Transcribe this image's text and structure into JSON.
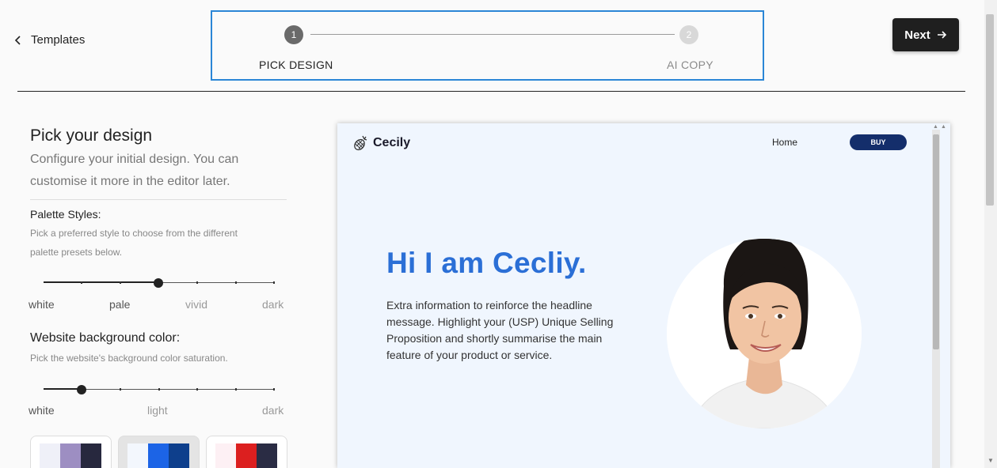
{
  "header": {
    "back_label": "Templates",
    "steps": [
      {
        "number": "1",
        "label": "PICK DESIGN"
      },
      {
        "number": "2",
        "label": "AI COPY"
      }
    ],
    "next_label": "Next"
  },
  "panel": {
    "title": "Pick your design",
    "description": "Configure your initial design. You can customise it more in the editor later.",
    "palette": {
      "label": "Palette Styles:",
      "help": "Pick a preferred style to choose from the different palette presets below.",
      "stops": [
        "white",
        "pale",
        "vivid",
        "dark"
      ],
      "selected": "pale"
    },
    "background": {
      "label": "Website background color:",
      "help": "Pick the website's background color saturation.",
      "stops": [
        "white",
        "light",
        "dark"
      ],
      "selected_fraction": 0.166
    },
    "swatches": [
      {
        "colors": [
          "#eff0f8",
          "#9d8ec2",
          "#27283e"
        ],
        "selected": false
      },
      {
        "colors": [
          "#f3f7fd",
          "#1c64e6",
          "#0e3f8c"
        ],
        "selected": true
      },
      {
        "colors": [
          "#fdf0f4",
          "#dc1f1f",
          "#2a2c44"
        ],
        "selected": false
      }
    ]
  },
  "preview": {
    "brand": "Cecily",
    "nav_home": "Home",
    "buy_label": "BUY",
    "hero_title": "Hi I am Cecliy.",
    "hero_text": "Extra information to reinforce the headline message. Highlight your (USP) Unique Selling Proposition and shortly summarise the main feature of your product or service.",
    "accent": "#2b6fd6",
    "button_color": "#142e6b"
  }
}
